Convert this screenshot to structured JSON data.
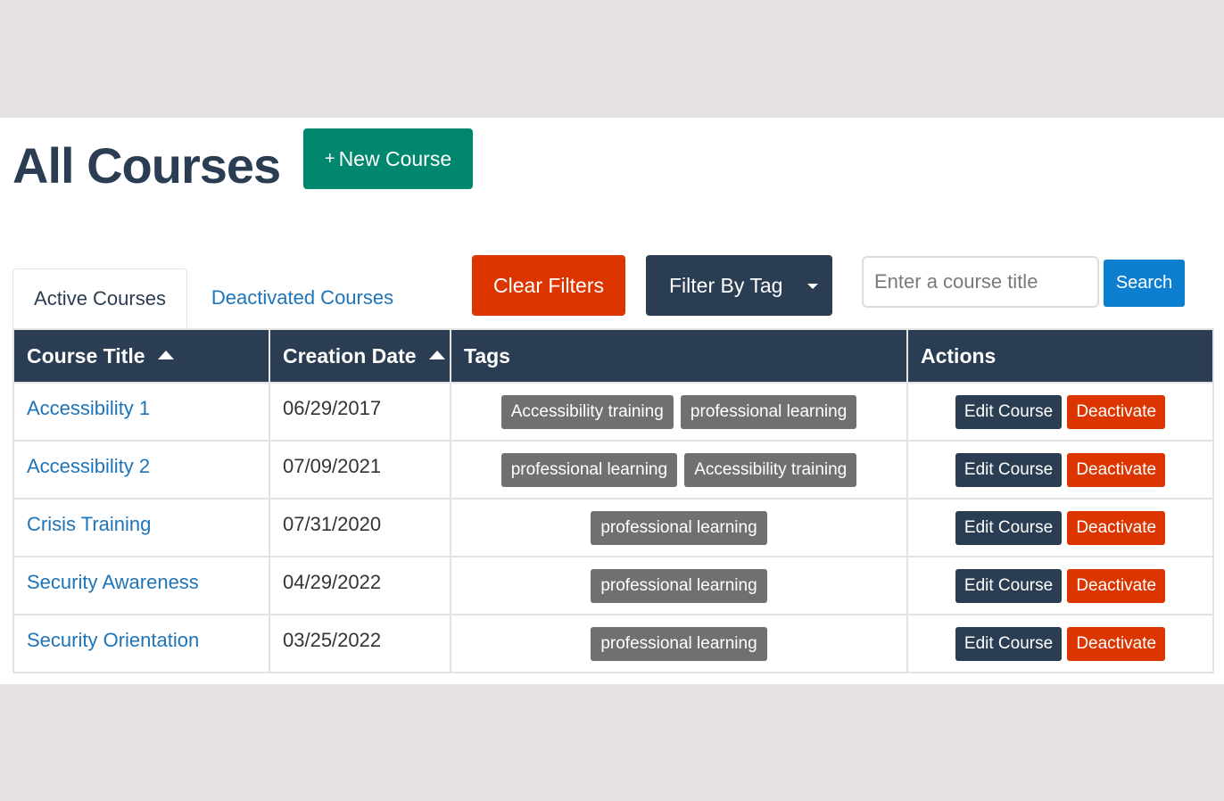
{
  "page": {
    "title": "All Courses",
    "new_course_label": "New Course",
    "new_course_icon": "plus-icon"
  },
  "tabs": [
    {
      "label": "Active Courses",
      "active": true
    },
    {
      "label": "Deactivated Courses",
      "active": false
    }
  ],
  "filters": {
    "clear_label": "Clear Filters",
    "filter_by_tag_label": "Filter By Tag",
    "search_placeholder": "Enter a course title",
    "search_value": "",
    "search_button_label": "Search"
  },
  "table": {
    "columns": [
      {
        "label": "Course Title",
        "sortable": true
      },
      {
        "label": "Creation Date",
        "sortable": true
      },
      {
        "label": "Tags",
        "sortable": false
      },
      {
        "label": "Actions",
        "sortable": false
      }
    ],
    "rows": [
      {
        "title": "Accessibility 1",
        "date": "06/29/2017",
        "tags": [
          "Accessibility training",
          "professional learning"
        ],
        "edit": "Edit Course",
        "deactivate": "Deactivate"
      },
      {
        "title": "Accessibility 2",
        "date": "07/09/2021",
        "tags": [
          "professional learning",
          "Accessibility training"
        ],
        "edit": "Edit Course",
        "deactivate": "Deactivate"
      },
      {
        "title": "Crisis Training",
        "date": "07/31/2020",
        "tags": [
          "professional learning"
        ],
        "edit": "Edit Course",
        "deactivate": "Deactivate"
      },
      {
        "title": "Security Awareness",
        "date": "04/29/2022",
        "tags": [
          "professional learning"
        ],
        "edit": "Edit Course",
        "deactivate": "Deactivate"
      },
      {
        "title": "Security Orientation",
        "date": "03/25/2022",
        "tags": [
          "professional learning"
        ],
        "edit": "Edit Course",
        "deactivate": "Deactivate"
      }
    ]
  },
  "colors": {
    "primary_dark": "#2a3d52",
    "new_course_green": "#00876d",
    "danger_orange": "#dd3500",
    "search_blue": "#0d7fd0",
    "link_blue": "#1d74b8",
    "tag_gray": "#707070"
  }
}
